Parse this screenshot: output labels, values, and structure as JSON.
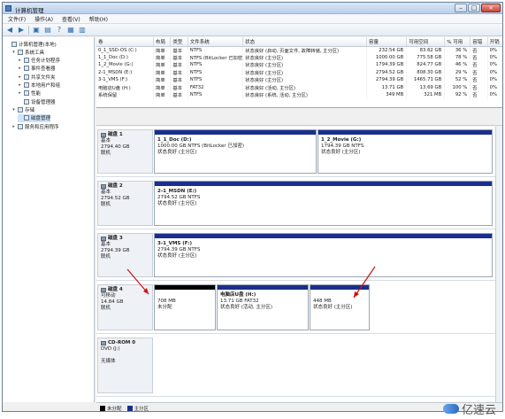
{
  "window": {
    "title": "计算机管理",
    "buttons": {
      "minimize": "–",
      "maximize": "□",
      "close": "×"
    }
  },
  "menubar": [
    "文件(F)",
    "操作(A)",
    "查看(V)",
    "帮助(H)"
  ],
  "toolbar": [
    "back-icon",
    "forward-icon",
    "up-icon",
    "properties-icon",
    "help-icon",
    "console-icon",
    "refresh-icon"
  ],
  "sidebar": [
    {
      "label": "计算机管理(本地)",
      "indent": 0,
      "exp": ""
    },
    {
      "label": "系统工具",
      "indent": 1,
      "exp": "▾"
    },
    {
      "label": "任务计划程序",
      "indent": 2,
      "exp": "▸"
    },
    {
      "label": "事件查看器",
      "indent": 2,
      "exp": "▸"
    },
    {
      "label": "共享文件夹",
      "indent": 2,
      "exp": "▸"
    },
    {
      "label": "本地用户和组",
      "indent": 2,
      "exp": "▸"
    },
    {
      "label": "性能",
      "indent": 2,
      "exp": "▸"
    },
    {
      "label": "设备管理器",
      "indent": 2,
      "exp": ""
    },
    {
      "label": "存储",
      "indent": 1,
      "exp": "▾"
    },
    {
      "label": "磁盘管理",
      "indent": 2,
      "exp": "",
      "selected": true
    },
    {
      "label": "服务和应用程序",
      "indent": 1,
      "exp": "▸"
    }
  ],
  "volume_table": {
    "headers": [
      "卷",
      "布局",
      "类型",
      "文件系统",
      "状态",
      "容量",
      "可用空间",
      "% 可用",
      "容错",
      "开销"
    ],
    "rows": [
      [
        "0_1_SSD-OS (C:)",
        "简单",
        "基本",
        "NTFS",
        "状态良好 (启动, 页面文件, 故障转储, 主分区)",
        "232.54 GB",
        "83.62 GB",
        "36 %",
        "否",
        "0%"
      ],
      [
        "1_1_Doc (D:)",
        "简单",
        "基本",
        "NTFS (BitLocker 已加密)",
        "状态良好 (主分区)",
        "1000.00 GB",
        "775.58 GB",
        "78 %",
        "否",
        "0%"
      ],
      [
        "1_2_Movie (G:)",
        "简单",
        "基本",
        "NTFS",
        "状态良好 (主分区)",
        "1794.39 GB",
        "824.77 GB",
        "46 %",
        "否",
        "0%"
      ],
      [
        "2-1_MSDN (E:)",
        "简单",
        "基本",
        "NTFS",
        "状态良好 (主分区)",
        "2794.52 GB",
        "808.30 GB",
        "29 %",
        "否",
        "0%"
      ],
      [
        "3-1_VMS (F:)",
        "简单",
        "基本",
        "NTFS",
        "状态良好 (主分区)",
        "2794.39 GB",
        "1465.71 GB",
        "52 %",
        "否",
        "0%"
      ],
      [
        "电脑店U盘 (H:)",
        "简单",
        "基本",
        "FAT32",
        "状态良好 (活动, 主分区)",
        "13.71 GB",
        "13.69 GB",
        "100 %",
        "否",
        "0%"
      ],
      [
        "系统保留",
        "简单",
        "基本",
        "NTFS",
        "状态良好 (系统, 活动, 主分区)",
        "349 MB",
        "321 MB",
        "92 %",
        "否",
        "0%"
      ]
    ]
  },
  "disks": [
    {
      "name": "磁盘 1",
      "type": "基本",
      "size": "2794.40 GB",
      "status": "联机",
      "partitions": [
        {
          "title": "1_1_Doc (D:)",
          "line2": "1000.00 GB NTFS (BitLocker 已加密)",
          "line3": "状态良好 (主分区)",
          "bar": "blue"
        },
        {
          "title": "1_2_Movie (G:)",
          "line2": "1794.39 GB NTFS",
          "line3": "状态良好 (主分区)",
          "bar": "blue"
        }
      ]
    },
    {
      "name": "磁盘 2",
      "type": "基本",
      "size": "2794.52 GB",
      "status": "联机",
      "partitions": [
        {
          "title": "2-1_MSDN (E:)",
          "line2": "2794.52 GB NTFS",
          "line3": "状态良好 (主分区)",
          "bar": "blue"
        }
      ]
    },
    {
      "name": "磁盘 3",
      "type": "基本",
      "size": "2794.39 GB",
      "status": "联机",
      "partitions": [
        {
          "title": "3-1_VMS (F:)",
          "line2": "2794.39 GB NTFS",
          "line3": "状态良好 (主分区)",
          "bar": "blue"
        }
      ]
    },
    {
      "name": "磁盘 4",
      "type": "可移动",
      "size": "14.84 GB",
      "status": "联机",
      "partitions": [
        {
          "title": "",
          "line2": "708 MB",
          "line3": "未分配",
          "bar": "black"
        },
        {
          "title": "电脑店U盘 (H:)",
          "line2": "13.71 GB FAT32",
          "line3": "状态良好 (活动, 主分区)",
          "bar": "blue"
        },
        {
          "title": "",
          "line2": "448 MB",
          "line3": "状态良好 (主分区)",
          "bar": "blue"
        }
      ]
    },
    {
      "name": "CD-ROM 0",
      "type": "DVD (J:)",
      "size": "",
      "status": "无媒体",
      "partitions": []
    }
  ],
  "legend": [
    {
      "label": "未分配",
      "color": "#000000"
    },
    {
      "label": "主分区",
      "color": "#1a2f8c"
    }
  ],
  "watermark": "亿速云"
}
